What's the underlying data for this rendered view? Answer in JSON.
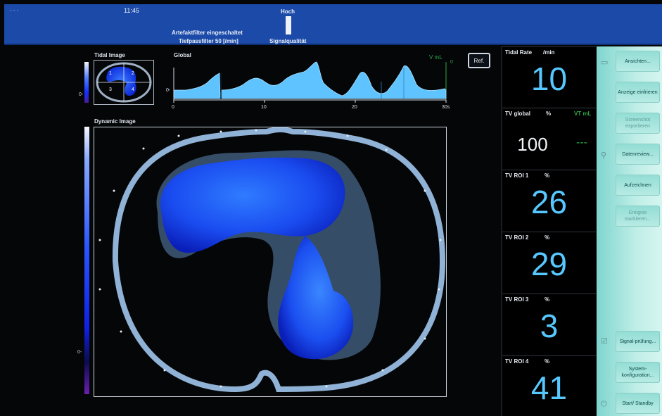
{
  "header": {
    "dashes": "- - -",
    "time": "11:45",
    "filter_line1": "Artefaktfilter eingeschaltet",
    "filter_line2": "Tiefpassfilter 50 [/min]",
    "signal_high_label": "Hoch",
    "signal_quality_label": "Signalqualität",
    "signal_quality_level": 1.0
  },
  "tidal_image": {
    "title": "Tidal Image",
    "scale_zero": "0-",
    "roi_labels": [
      "1",
      "2",
      "3",
      "4"
    ]
  },
  "global_curve": {
    "title": "Global",
    "unit_top": "V mL",
    "y_zero_right": "0",
    "y_zero_left": "0-",
    "x_ticks": [
      "0",
      "10",
      "20",
      "30s"
    ],
    "ref_button": "Ref."
  },
  "dynamic_image": {
    "title": "Dynamic Image",
    "scale_zero": "0-"
  },
  "tiles": [
    {
      "label": "Tidal Rate",
      "unit": "/min",
      "value": "10"
    },
    {
      "label": "TV global",
      "unit": "%",
      "extra": "VT mL",
      "value": "100",
      "dash": "---"
    },
    {
      "label": "TV ROI 1",
      "unit": "%",
      "value": "26"
    },
    {
      "label": "TV ROI 2",
      "unit": "%",
      "value": "29"
    },
    {
      "label": "TV ROI 3",
      "unit": "%",
      "value": "3"
    },
    {
      "label": "TV ROI 4",
      "unit": "%",
      "value": "41"
    }
  ],
  "side_panel": {
    "buttons": [
      {
        "label": "Ansichten...",
        "enabled": true
      },
      {
        "label": "Anzeige einfrieren",
        "enabled": true
      },
      {
        "label": "Screenshot exportieren",
        "enabled": false
      },
      {
        "label": "Datenreview...",
        "enabled": true
      },
      {
        "label": "Aufzeichnen",
        "enabled": true
      },
      {
        "label": "Ereignis markieren...",
        "enabled": false
      },
      {
        "label": "Signal-prüfung...",
        "enabled": true
      },
      {
        "label": "System-konfiguration...",
        "enabled": true
      },
      {
        "label": "Start/ Standby",
        "enabled": true
      }
    ],
    "icons": [
      "monitor-icon",
      "magnifier-icon",
      "checkbox-icon",
      "power-icon"
    ]
  },
  "colors": {
    "header_blue": "#1b4aa8",
    "value_cyan": "#57c8ff",
    "panel_teal": "#a8e6df",
    "lung_blue": "#1e5bff"
  }
}
